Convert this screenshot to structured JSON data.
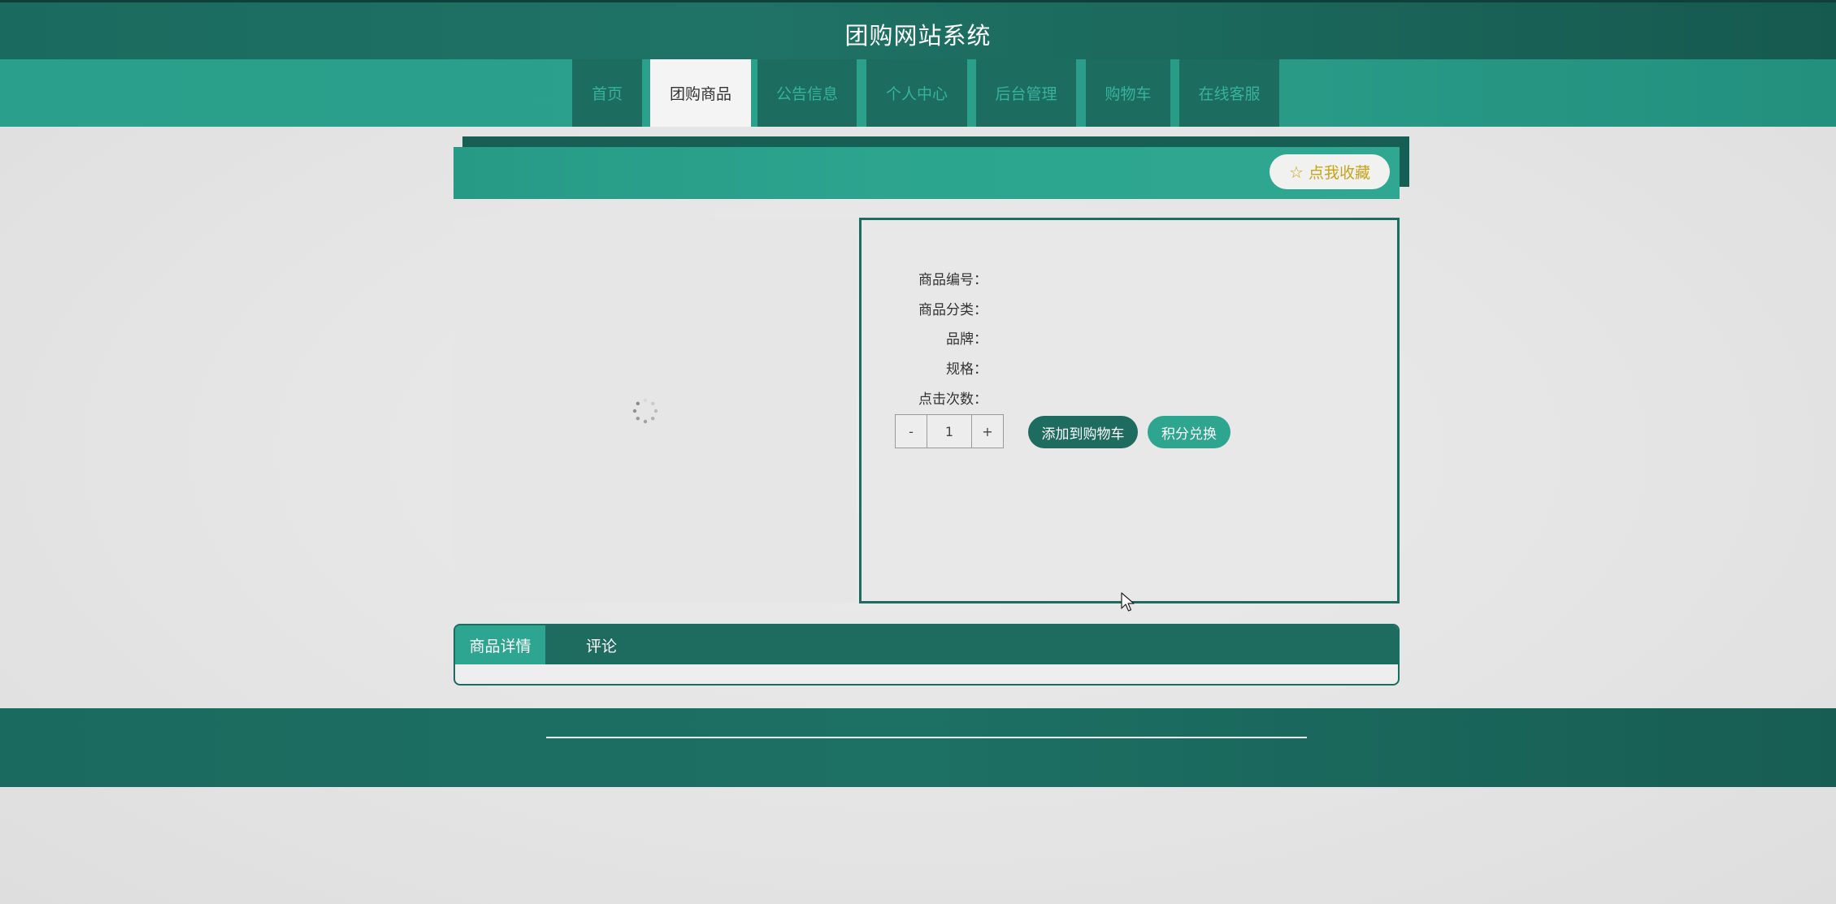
{
  "header": {
    "site_title": "团购网站系统"
  },
  "nav": {
    "items": [
      {
        "label": "首页",
        "active": false
      },
      {
        "label": "团购商品",
        "active": true
      },
      {
        "label": "公告信息",
        "active": false
      },
      {
        "label": "个人中心",
        "active": false
      },
      {
        "label": "后台管理",
        "active": false
      },
      {
        "label": "购物车",
        "active": false
      },
      {
        "label": "在线客服",
        "active": false
      }
    ]
  },
  "banner": {
    "favorite_label": "点我收藏",
    "favorite_icon": "star-outline-icon"
  },
  "product": {
    "image_state": "loading",
    "fields": [
      {
        "label": "商品编号：",
        "value": ""
      },
      {
        "label": "商品分类：",
        "value": ""
      },
      {
        "label": "品牌：",
        "value": ""
      },
      {
        "label": "规格：",
        "value": ""
      },
      {
        "label": "点击次数：",
        "value": ""
      }
    ],
    "quantity": {
      "minus": "-",
      "value": "1",
      "plus": "+"
    },
    "add_to_cart_label": "添加到购物车",
    "redeem_points_label": "积分兑换"
  },
  "detail_tabs": {
    "items": [
      {
        "label": "商品详情",
        "active": true
      },
      {
        "label": "评论",
        "active": false
      }
    ]
  },
  "colors": {
    "primary_dark": "#1e6b5f",
    "primary": "#2da590",
    "favorite_text": "#c8a31b"
  }
}
